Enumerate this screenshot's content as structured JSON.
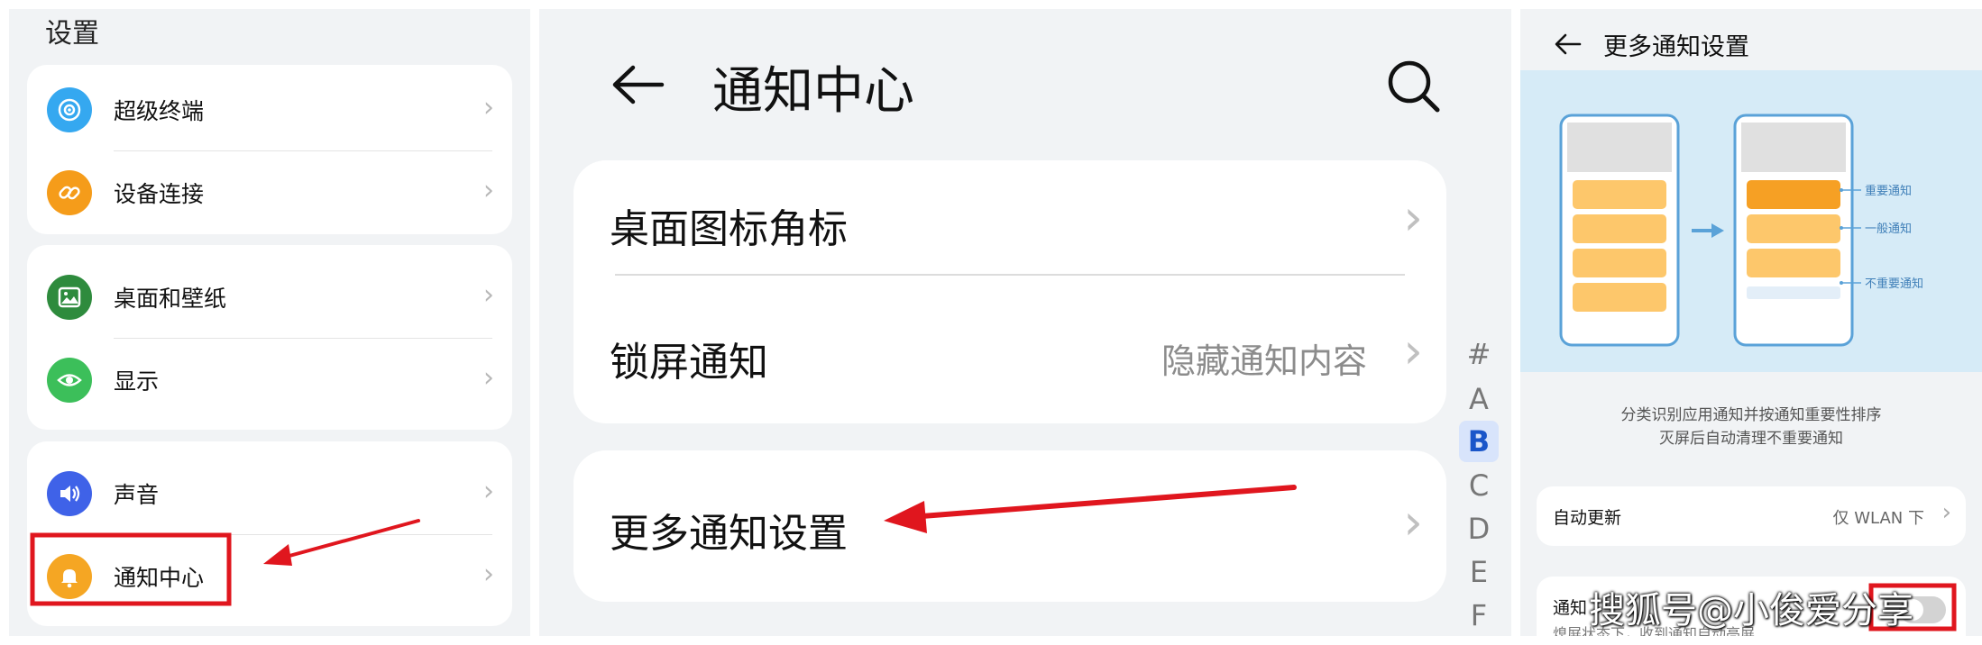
{
  "panel1": {
    "title": "设置",
    "groups": [
      {
        "items": [
          {
            "label": "超级终端",
            "icon": "super-device-icon",
            "color": "#35a8f0"
          },
          {
            "label": "设备连接",
            "icon": "link-icon",
            "color": "#f59c1a"
          }
        ]
      },
      {
        "items": [
          {
            "label": "桌面和壁纸",
            "icon": "wallpaper-icon",
            "color": "#2e8b3d"
          },
          {
            "label": "显示",
            "icon": "eye-icon",
            "color": "#3cbf5a"
          }
        ]
      },
      {
        "items": [
          {
            "label": "声音",
            "icon": "speaker-icon",
            "color": "#3f62e8"
          },
          {
            "label": "通知中心",
            "icon": "bell-icon",
            "color": "#f5a623"
          }
        ]
      }
    ],
    "chevron": "›"
  },
  "panel2": {
    "title": "通知中心",
    "back_icon": "back-arrow-icon",
    "search_icon": "search-icon",
    "badges_label": "桌面图标角标",
    "lock_label": "锁屏通知",
    "lock_value": "隐藏通知内容",
    "more_label": "更多通知设置",
    "chevron": "›",
    "index": [
      "#",
      "A",
      "B",
      "C",
      "D",
      "E",
      "F"
    ],
    "index_active": "B"
  },
  "panel3": {
    "title": "更多通知设置",
    "back_icon": "back-arrow-icon",
    "illustration": {
      "label_important": "重要通知",
      "label_normal": "一般通知",
      "label_unimportant": "不重要通知"
    },
    "desc_line1": "分类识别应用通知并按通知重要性排序",
    "desc_line2": "灭屏后自动清理不重要通知",
    "auto_update_label": "自动更新",
    "auto_update_value": "仅 WLAN 下",
    "notify_label": "通知",
    "notify_sub": "熄屏状态下，收到通知自动亮屏",
    "chevron": "›"
  },
  "watermark": "搜狐号@小俊爱分享",
  "colors": {
    "panel_bg": "#f1f3f5",
    "highlight": "#e0161e",
    "accent_blue": "#1a56c9"
  }
}
